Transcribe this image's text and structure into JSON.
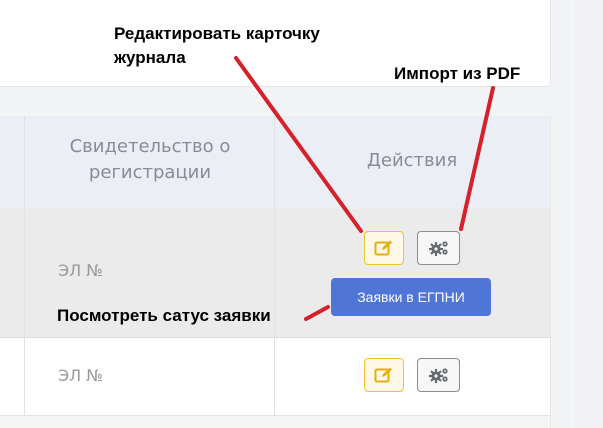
{
  "table": {
    "headers": {
      "certificate": "Свидетельство о регистрации",
      "actions": "Действия"
    },
    "rows": [
      {
        "certificate": "ЭЛ №"
      },
      {
        "certificate": "ЭЛ №"
      }
    ]
  },
  "actions": {
    "edit_icon": "pencil-square-icon",
    "gear_icon": "gears-icon"
  },
  "tooltip": "Заявки в ЕГПНИ",
  "annotations": {
    "edit_card": "Редактировать карточку журнала",
    "import_pdf": "Импорт из PDF",
    "view_status": "Посмотреть сатус заявки"
  },
  "colors": {
    "header_bg": "#eceef5",
    "tooltip_bg": "#4f75d6",
    "edit_border": "#f2c230",
    "arrow": "#d6202a"
  }
}
